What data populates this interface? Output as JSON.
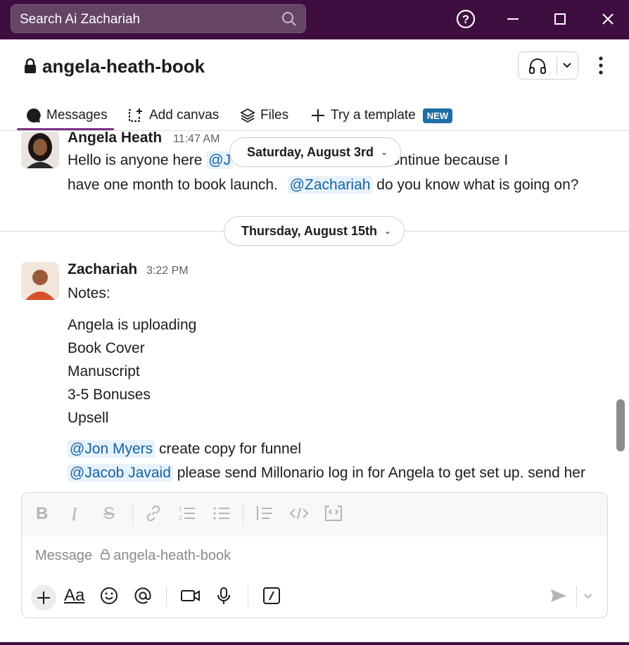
{
  "search": {
    "placeholder": "Search Ai Zachariah"
  },
  "channel": {
    "title": "angela-heath-book"
  },
  "tabs": [
    {
      "label": "Messages"
    },
    {
      "label": "Add canvas"
    },
    {
      "label": "Files"
    },
    {
      "label": "Try a template",
      "badge": "NEW"
    }
  ],
  "messages": [
    {
      "author": "Angela Heath",
      "time": "11:47 AM",
      "line1_pre": "Hello is anyone here",
      "line1_mention": "@J",
      "line1_post": "able to continue because I",
      "line2_pre": "have one month to book launch.",
      "line2_mention": "@Zachariah",
      "line2_post": "do you know what is going on?"
    },
    {
      "author": "Zachariah",
      "time": "3:22 PM",
      "notes_label": "Notes:",
      "list": [
        "Angela is uploading",
        "Book Cover",
        "Manuscript",
        "3-5 Bonuses",
        "Upsell"
      ],
      "mention1": "@Jon Myers",
      "mention1_text": "create copy for funnel",
      "mention2": "@Jacob Javaid",
      "mention2_text": "please send Millonario log in for Angela to get set up. send her"
    }
  ],
  "dates": {
    "first": "Saturday, August 3rd",
    "second": "Thursday, August 15th"
  },
  "composer": {
    "placeholder_prefix": "Message",
    "placeholder_channel": "angela-heath-book"
  },
  "colors": {
    "titlebar": "#3f0e40",
    "mention_bg": "#e8f2fb",
    "mention_text": "#1264a3",
    "badge": "#1d6fa5",
    "tab_underline": "#7c3085"
  }
}
